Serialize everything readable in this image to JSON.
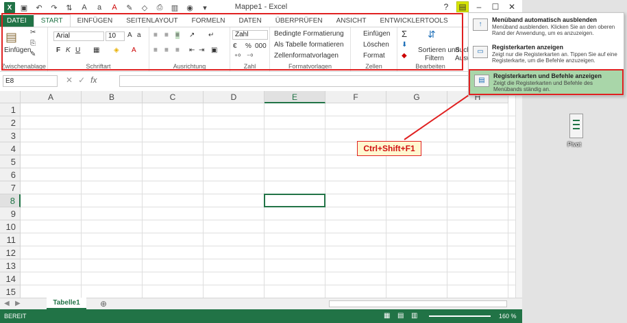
{
  "window": {
    "title": "Mappe1 - Excel"
  },
  "tabs": [
    "DATEI",
    "START",
    "EINFÜGEN",
    "SEITENLAYOUT",
    "FORMELN",
    "DATEN",
    "ÜBERPRÜFEN",
    "ANSICHT",
    "ENTWICKLERTOOLS"
  ],
  "ribbon": {
    "paste_label": "Einfügen",
    "groups": {
      "clipboard": "Zwischenablage",
      "font": "Schriftart",
      "alignment": "Ausrichtung",
      "number": "Zahl",
      "styles": "Formatvorlagen",
      "cells": "Zellen",
      "editing": "Bearbeiten"
    },
    "font_name": "Arial",
    "font_size": "10",
    "number_format": "Zahl",
    "bold": "F",
    "italic": "K",
    "underline": "U",
    "conditional": "Bedingte Formatierung",
    "as_table": "Als Tabelle formatieren",
    "cell_styles": "Zellenformatvorlagen",
    "insert": "Einfügen",
    "delete": "Löschen",
    "format": "Format",
    "sort1": "Sortieren und",
    "sort2": "Filtern",
    "search1": "Such",
    "search2": "Ausw"
  },
  "formula_bar": {
    "name_box": "E8",
    "fx": "fx",
    "value": ""
  },
  "columns": [
    "A",
    "B",
    "C",
    "D",
    "E",
    "F",
    "G",
    "H"
  ],
  "rows": [
    "1",
    "2",
    "3",
    "4",
    "5",
    "6",
    "7",
    "8",
    "9",
    "10",
    "11",
    "12",
    "13",
    "14",
    "15"
  ],
  "selected_cell": "E8",
  "sheet": {
    "tab": "Tabelle1"
  },
  "status": {
    "text": "BEREIT",
    "zoom": "160 %"
  },
  "callout": "Ctrl+Shift+F1",
  "menu": {
    "items": [
      {
        "title": "Menüband automatisch ausblenden",
        "desc": "Menüband ausblenden. Klicken Sie an den oberen Rand der Anwendung, um es anzuzeigen."
      },
      {
        "title": "Registerkarten anzeigen",
        "desc": "Zeigt nur die Registerkarten an. Tippen Sie auf eine Registerkarte, um die Befehle anzuzeigen."
      },
      {
        "title": "Registerkarten und Befehle anzeigen",
        "desc": "Zeigt die Registerkarten und Befehle des Menübands ständig an."
      }
    ]
  },
  "desktop": {
    "icon_label": "Pivot"
  },
  "colors": {
    "accent": "#217346",
    "highlight": "#e02020"
  }
}
